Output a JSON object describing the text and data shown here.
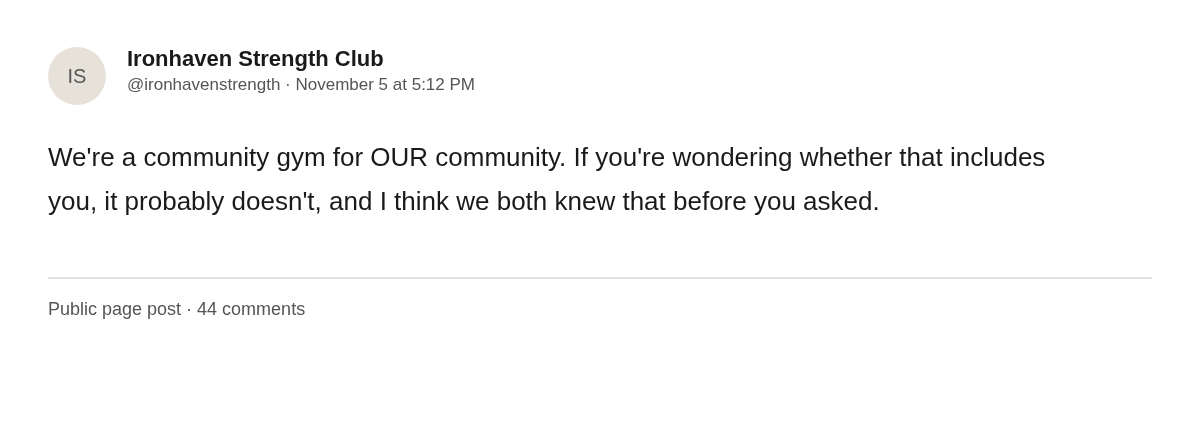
{
  "post": {
    "author": {
      "initials": "IS",
      "name": "Ironhaven Strength Club",
      "handle": "@ironhavenstrength",
      "separator": "·",
      "timestamp": "November 5 at 5:12 PM"
    },
    "body": "We're a community gym for OUR community. If you're wondering whether that includes you, it probably doesn't, and I think we both knew that before you asked.",
    "footer": {
      "type": "Public page post",
      "separator": "·",
      "comments": "44 comments"
    }
  }
}
